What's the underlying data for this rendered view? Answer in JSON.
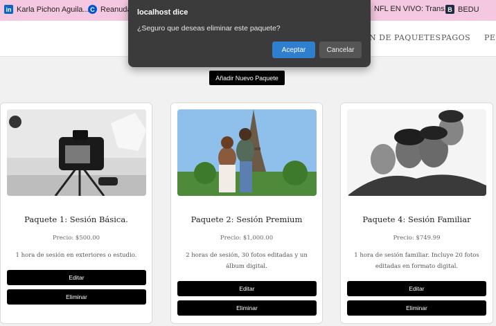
{
  "bookmarks": [
    {
      "label": "Karla Pichon Aguila...",
      "icon": "linkedin-icon",
      "color": "#0a66c2",
      "glyph": "in"
    },
    {
      "label": "Reanudar",
      "icon": "coursera-icon",
      "color": "#0056d2",
      "glyph": "C"
    },
    {
      "label": "NFL EN VIVO: Trans...",
      "icon": "page-icon",
      "color": "#888888",
      "glyph": ""
    },
    {
      "label": "BEDU",
      "icon": "bedu-icon",
      "color": "#1f2a44",
      "glyph": "B"
    }
  ],
  "nav": {
    "items": [
      "N DE PAQUETES",
      "PAGOS",
      "PER"
    ]
  },
  "dialog": {
    "title": "localhost dice",
    "message": "¿Seguro que deseas eliminar este paquete?",
    "ok_label": "Aceptar",
    "cancel_label": "Cancelar"
  },
  "add_button_label": "Añadir Nuevo Paquete",
  "cards": [
    {
      "title": "Paquete 1: Sesión Básica.",
      "price": "Precio: $500.00",
      "description": "1 hora de sesión en exteriores o estudio.",
      "edit_label": "Editar",
      "delete_label": "Eliminar"
    },
    {
      "title": "Paquete 2: Sesión Premium",
      "price": "Precio: $1,000.00",
      "description": "2 horas de sesión, 30 fotos editadas y un álbum digital.",
      "edit_label": "Editar",
      "delete_label": "Eliminar"
    },
    {
      "title": "Paquete 4: Sesión Familiar",
      "price": "Precio: $749.99",
      "description": "1 hora de sesión familiar. Incluye 20 fotos editadas en formato digital.",
      "edit_label": "Editar",
      "delete_label": "Eliminar"
    }
  ]
}
